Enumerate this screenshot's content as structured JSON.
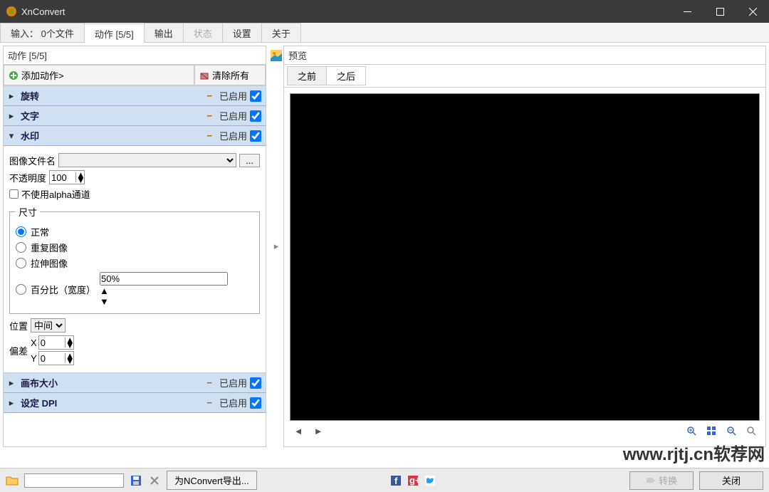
{
  "title": "XnConvert",
  "tabs": {
    "input": "输入： 0个文件",
    "actions": "动作 [5/5]",
    "output": "输出",
    "status": "状态",
    "settings": "设置",
    "about": "关于"
  },
  "left": {
    "header": "动作 [5/5]",
    "add": "添加动作>",
    "clear": "清除所有",
    "enabled_label": "已启用",
    "actions": {
      "rotate": "旋转",
      "text": "文字",
      "watermark": "水印",
      "canvas": "画布大小",
      "dpi": "设定 DPI"
    },
    "wm": {
      "file_label": "图像文件名",
      "file_value": "",
      "browse": "...",
      "opacity_label": "不透明度",
      "opacity_value": "100",
      "no_alpha": "不使用alpha通道",
      "size_legend": "尺寸",
      "r_normal": "正常",
      "r_tile": "重复图像",
      "r_stretch": "拉伸图像",
      "r_percent": "百分比（宽度）",
      "percent_value": "50%",
      "pos_label": "位置",
      "pos_value": "中间",
      "offset_label": "偏差",
      "x_label": "X",
      "x_value": "0",
      "y_label": "Y",
      "y_value": "0"
    }
  },
  "preview": {
    "header": "预览",
    "before": "之前",
    "after": "之后"
  },
  "footer": {
    "export": "为NConvert导出...",
    "convert": "转换",
    "close": "关闭"
  },
  "overlay": "www.rjtj.cn软荐网"
}
